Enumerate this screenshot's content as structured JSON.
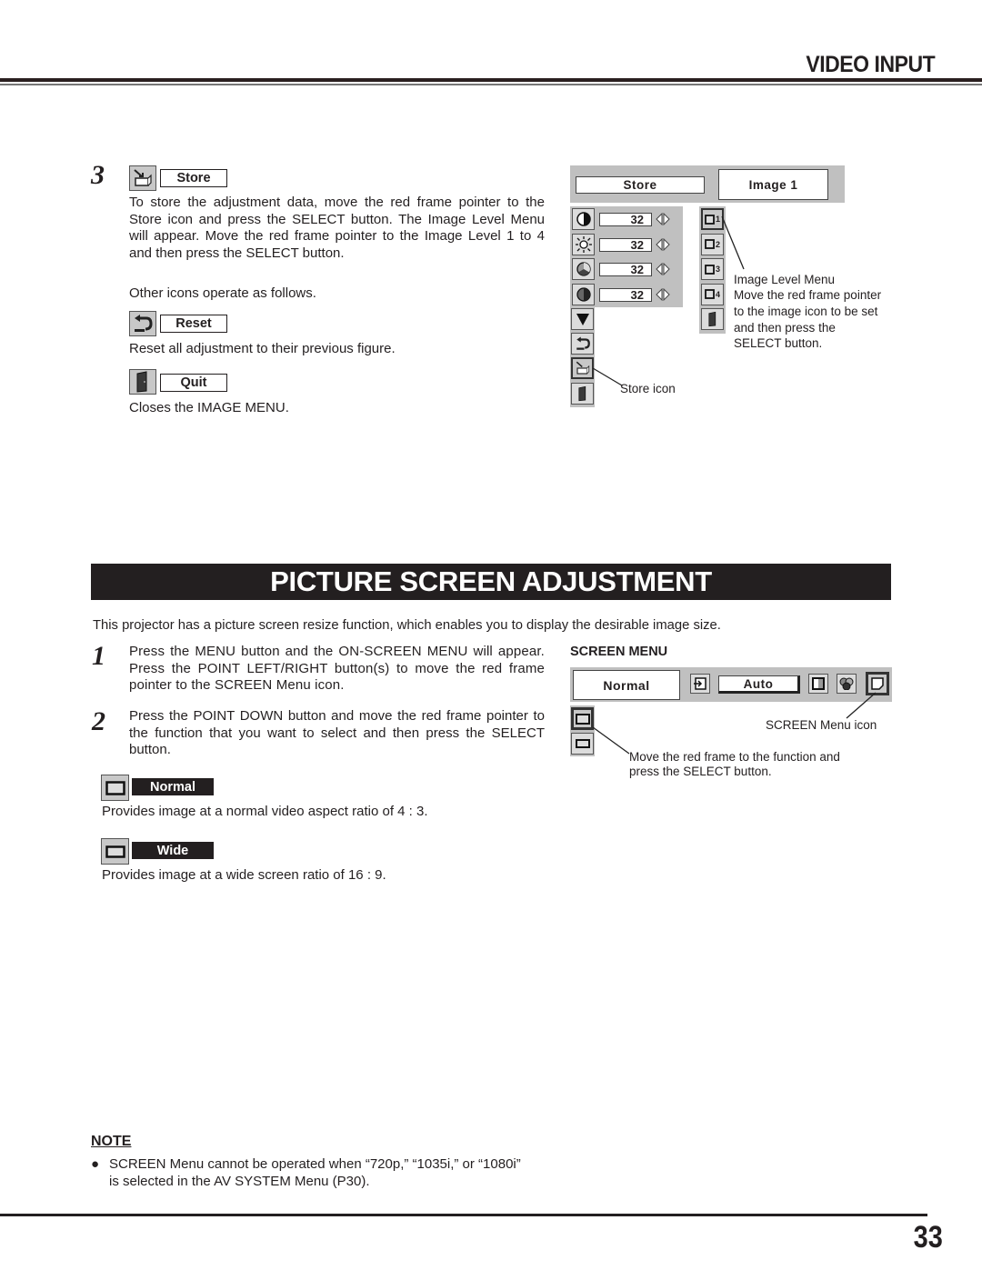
{
  "header": {
    "section_title": "VIDEO INPUT"
  },
  "store_section": {
    "step_number": "3",
    "store_label": "Store",
    "store_text": "To store the adjustment data, move the red frame pointer to the Store icon and press the SELECT button.  The Image Level Menu will appear.  Move the red frame pointer to the Image Level 1 to 4 and then press the SELECT button.",
    "other_icons_text": "Other icons operate as follows.",
    "reset_label": "Reset",
    "reset_text": "Reset all adjustment to their previous figure.",
    "quit_label": "Quit",
    "quit_text": "Closes the IMAGE MENU."
  },
  "image_menu_figure": {
    "store_field": "Store",
    "image_field": "Image 1",
    "rows": [
      {
        "icon": "contrast-icon",
        "value": "32"
      },
      {
        "icon": "brightness-icon",
        "value": "32"
      },
      {
        "icon": "color-icon",
        "value": "32"
      },
      {
        "icon": "tint-icon",
        "value": "32"
      }
    ],
    "side_icons": [
      "down-arrow-icon",
      "reset-icon",
      "store-icon",
      "quit-icon"
    ],
    "level_icons": [
      "1",
      "2",
      "3",
      "4"
    ],
    "store_icon_caption": "Store icon",
    "level_caption_title": "Image Level Menu",
    "level_caption_lines": [
      "Move the red frame pointer",
      "to the image icon to be set",
      "and then press the",
      "SELECT button."
    ]
  },
  "picture_section": {
    "banner_title": "PICTURE SCREEN ADJUSTMENT",
    "intro": "This projector has a picture screen resize function, which enables you to display the desirable image size.",
    "step1_number": "1",
    "step1_text": "Press the MENU button and the ON-SCREEN MENU will appear.  Press the POINT LEFT/RIGHT button(s) to move the red frame pointer to the SCREEN Menu icon.",
    "step2_number": "2",
    "step2_text": "Press the POINT DOWN button and move the red frame pointer to the function that you want to select and then press the SELECT button.",
    "normal_label": "Normal",
    "normal_text": "Provides image at a normal video aspect ratio of 4 : 3.",
    "wide_label": "Wide",
    "wide_text": "Provides image at a wide screen ratio of 16 : 9."
  },
  "screen_menu_figure": {
    "title": "SCREEN MENU",
    "mode_field": "Normal",
    "auto_field": "Auto",
    "icon_caption": "SCREEN Menu icon",
    "function_caption_lines": [
      "Move the red frame to the function and",
      "press the SELECT button."
    ]
  },
  "note": {
    "title": "NOTE",
    "bullet": "●",
    "text_lines": [
      "SCREEN Menu cannot be operated when “720p,” “1035i,” or “1080i”",
      "is selected in the AV SYSTEM Menu (P30)."
    ]
  },
  "footer": {
    "page_number": "33"
  }
}
